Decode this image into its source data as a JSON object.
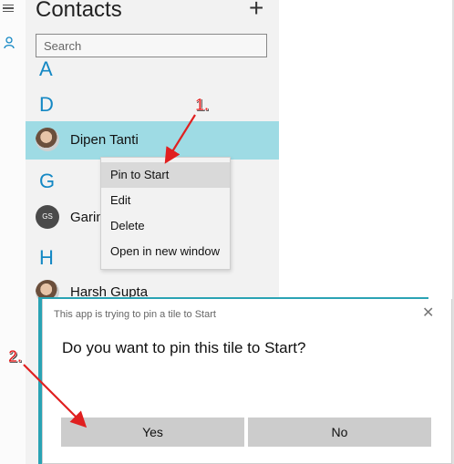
{
  "app": {
    "title": "Contacts",
    "add_label": "+",
    "search": {
      "placeholder": "Search",
      "value": ""
    }
  },
  "groups": [
    {
      "letter": "A"
    },
    {
      "letter": "D",
      "contacts": [
        {
          "name": "Dipen Tanti",
          "avatar": "photo",
          "selected": true
        }
      ]
    },
    {
      "letter": "G",
      "contacts": [
        {
          "name": "Garin",
          "initials": "GS",
          "avatar": "initials"
        }
      ]
    },
    {
      "letter": "H",
      "contacts": [
        {
          "name": "Harsh Gupta",
          "avatar": "photo"
        }
      ]
    }
  ],
  "context_menu": {
    "items": [
      "Pin to Start",
      "Edit",
      "Delete",
      "Open in new window"
    ],
    "highlighted": "Pin to Start"
  },
  "dialog": {
    "caption": "This app is trying to pin a tile to Start",
    "close": "✕",
    "message": "Do you want to pin this tile to Start?",
    "yes": "Yes",
    "no": "No"
  },
  "annotations": {
    "step1": "1.",
    "step2": "2."
  },
  "colors": {
    "accent": "#1488c4",
    "selected_row": "#9edbe4",
    "arrow": "#e02020",
    "teal": "#2aa3b4"
  }
}
